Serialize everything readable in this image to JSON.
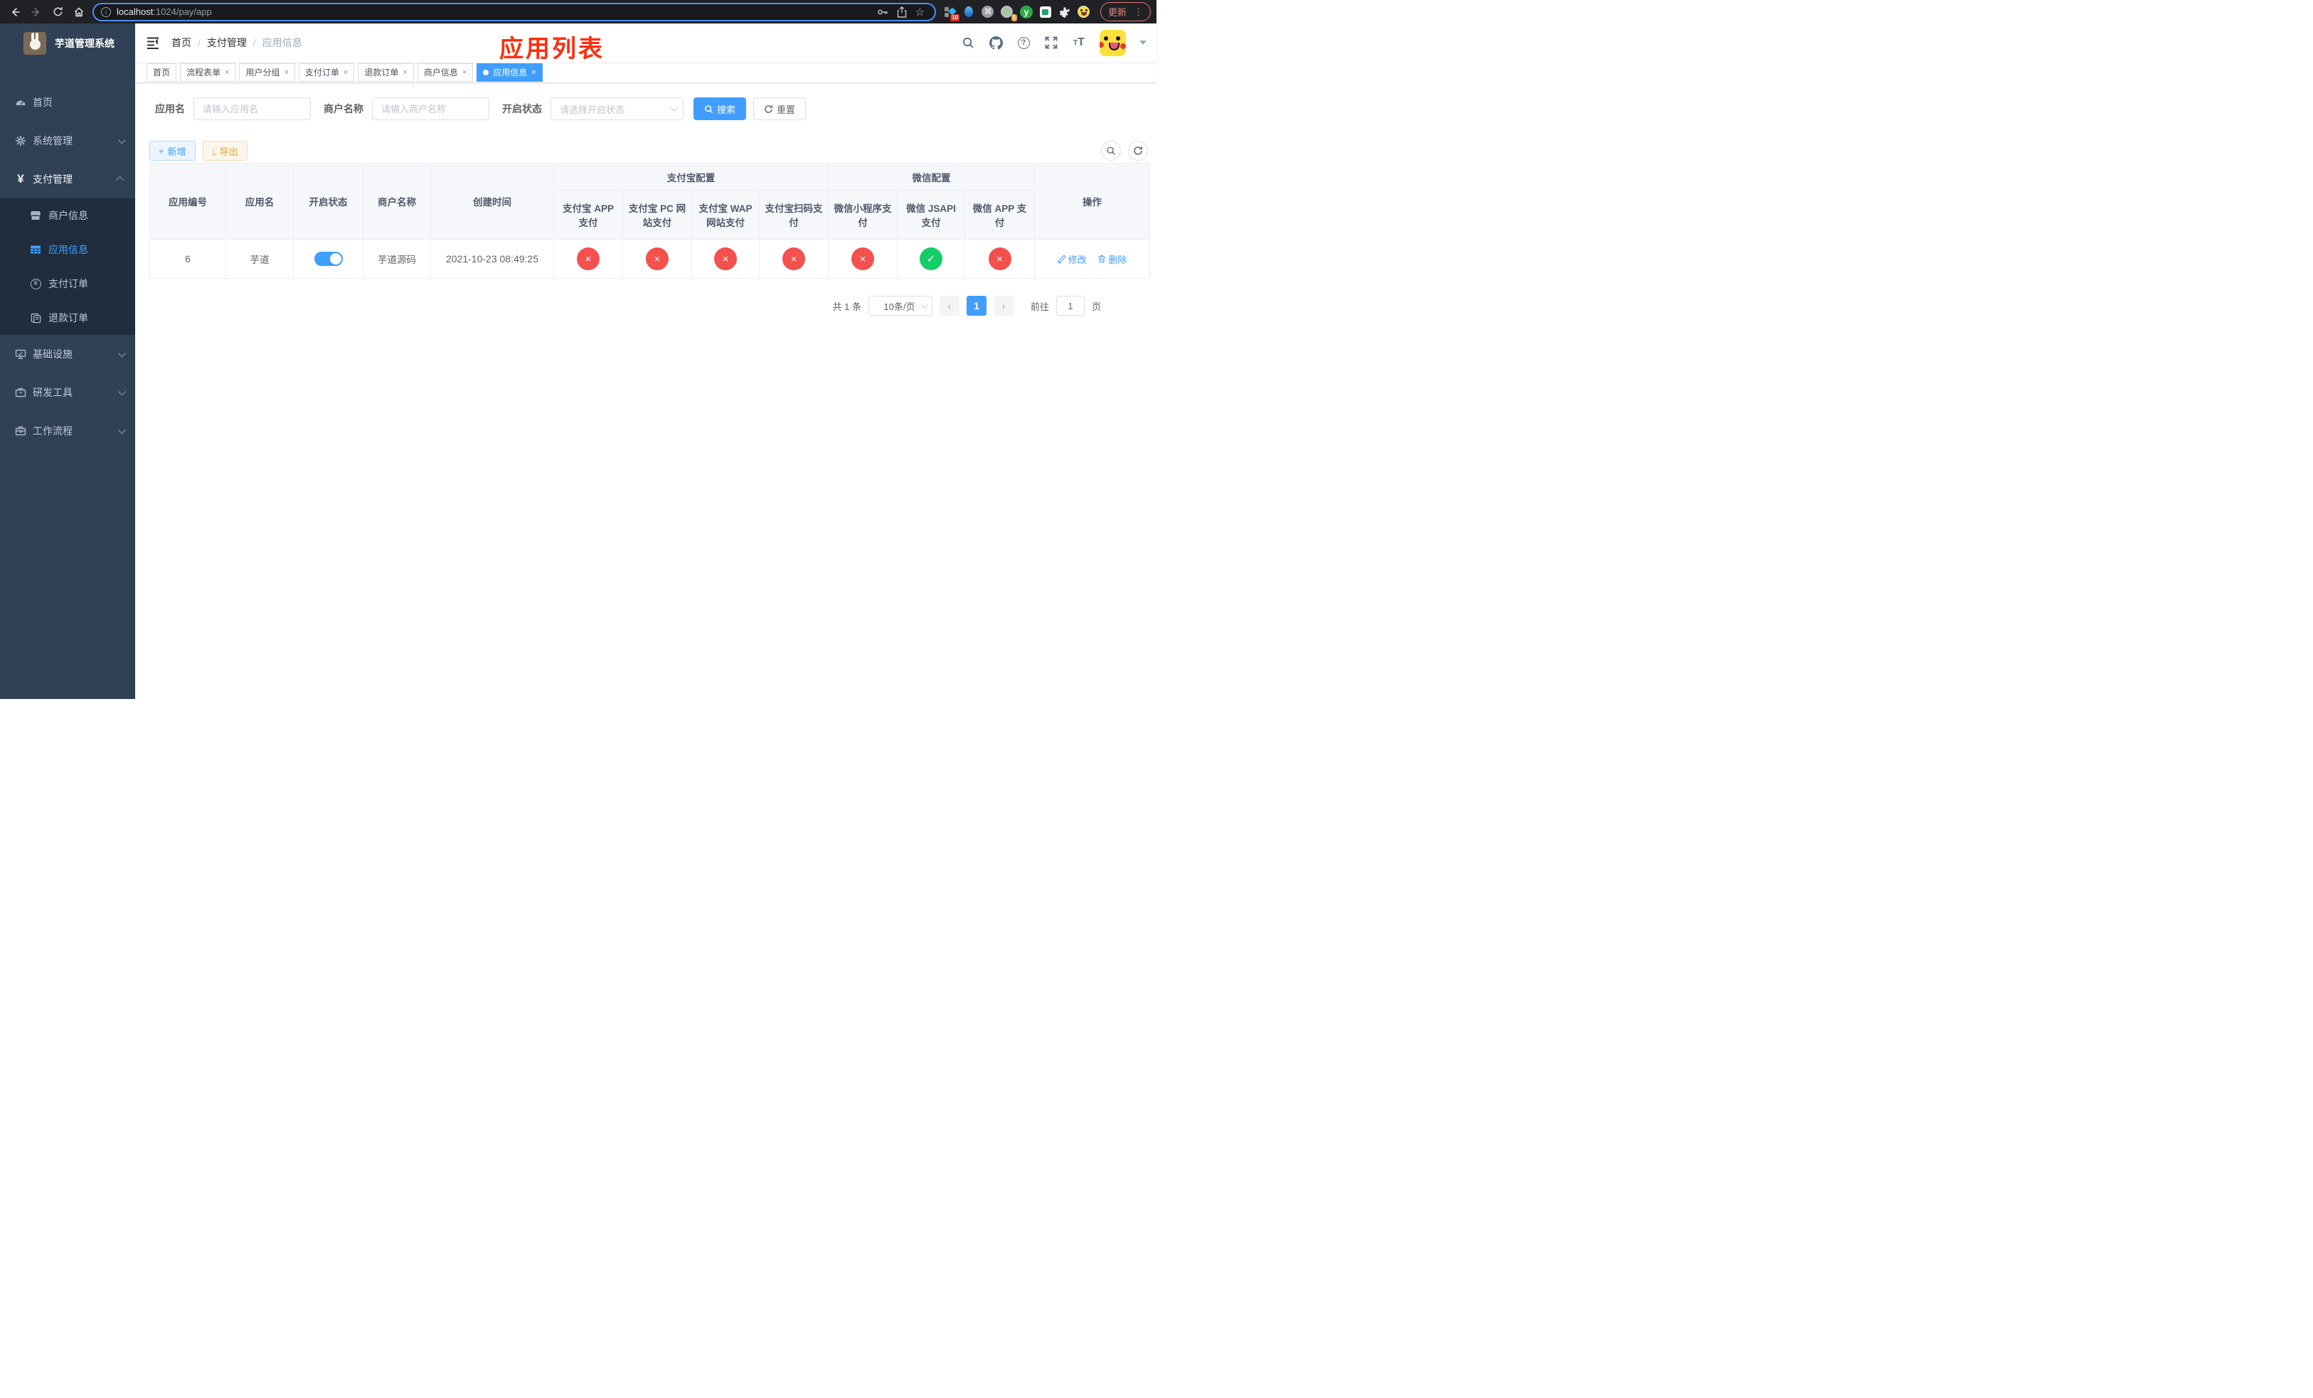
{
  "colors": {
    "accent": "#409EFF",
    "success": "#13ce66",
    "danger": "#f4504d",
    "warning": "#e6a23c",
    "sidebar_bg": "#304156",
    "submenu_bg": "#1f2d3d",
    "annotation": "#fb2f0d"
  },
  "browser": {
    "url_host": "localhost",
    "url_rest": ":1024/pay/app",
    "badge_ten": "10",
    "badge_one": "1",
    "ext_y_letter": "y",
    "cmd_glyph": "⌘",
    "update_label": "更新",
    "menu_glyph": "⋮",
    "star_glyph": "☆"
  },
  "sidebar": {
    "title": "芋道管理系统",
    "home": "首页",
    "system": "系统管理",
    "payment": "支付管理",
    "merchant_info": "商户信息",
    "app_info": "应用信息",
    "pay_order": "支付订单",
    "refund_order": "退款订单",
    "infra": "基础设施",
    "dev_tools": "研发工具",
    "workflow": "工作流程",
    "yen_glyph": "¥",
    "coin_glyph": "¥"
  },
  "header": {
    "breadcrumb": [
      "首页",
      "支付管理",
      "应用信息"
    ],
    "sep": "/",
    "annotation": "应用列表",
    "fontsize_small": "T",
    "fontsize_big": "T",
    "help_glyph": "?"
  },
  "tabs": {
    "close_glyph": "×",
    "items": [
      {
        "label": "首页",
        "closable": false,
        "active": false
      },
      {
        "label": "流程表单",
        "closable": true,
        "active": false
      },
      {
        "label": "用户分组",
        "closable": true,
        "active": false
      },
      {
        "label": "支付订单",
        "closable": true,
        "active": false
      },
      {
        "label": "退款订单",
        "closable": true,
        "active": false
      },
      {
        "label": "商户信息",
        "closable": true,
        "active": false
      },
      {
        "label": "应用信息",
        "closable": true,
        "active": true
      }
    ]
  },
  "filters": {
    "app_name_label": "应用名",
    "app_name_placeholder": "请输入应用名",
    "merchant_label": "商户名称",
    "merchant_placeholder": "请输入商户名称",
    "status_label": "开启状态",
    "status_placeholder": "请选择开启状态",
    "search_label": "搜索",
    "reset_label": "重置"
  },
  "toolbar": {
    "add_label": "新增",
    "add_glyph": "+",
    "export_label": "导出",
    "export_glyph": "↓"
  },
  "table": {
    "columns": [
      "应用编号",
      "应用名",
      "开启状态",
      "商户名称",
      "创建时间"
    ],
    "group_alipay": "支付宝配置",
    "group_wechat": "微信配置",
    "alipay_cols": [
      "支付宝 APP 支付",
      "支付宝 PC 网站支付",
      "支付宝 WAP 网站支付",
      "支付宝扫码支付"
    ],
    "wechat_cols": [
      "微信小程序支付",
      "微信 JSAPI 支付",
      "微信 APP 支付"
    ],
    "actions_col": "操作",
    "glyph_ok": "✓",
    "glyph_no": "×",
    "rows": [
      {
        "id": "6",
        "name": "芋道",
        "enabled": true,
        "merchant": "芋道源码",
        "created": "2021-10-23 08:49:25",
        "channels": [
          false,
          false,
          false,
          false,
          false,
          true,
          false
        ],
        "edit_label": "修改",
        "delete_label": "删除"
      }
    ]
  },
  "pagination": {
    "total": "共 1 条",
    "page_size": "10条/页",
    "prev_glyph": "‹",
    "next_glyph": "›",
    "current_page": "1",
    "goto_label": "前往",
    "goto_value": "1",
    "page_unit": "页"
  }
}
